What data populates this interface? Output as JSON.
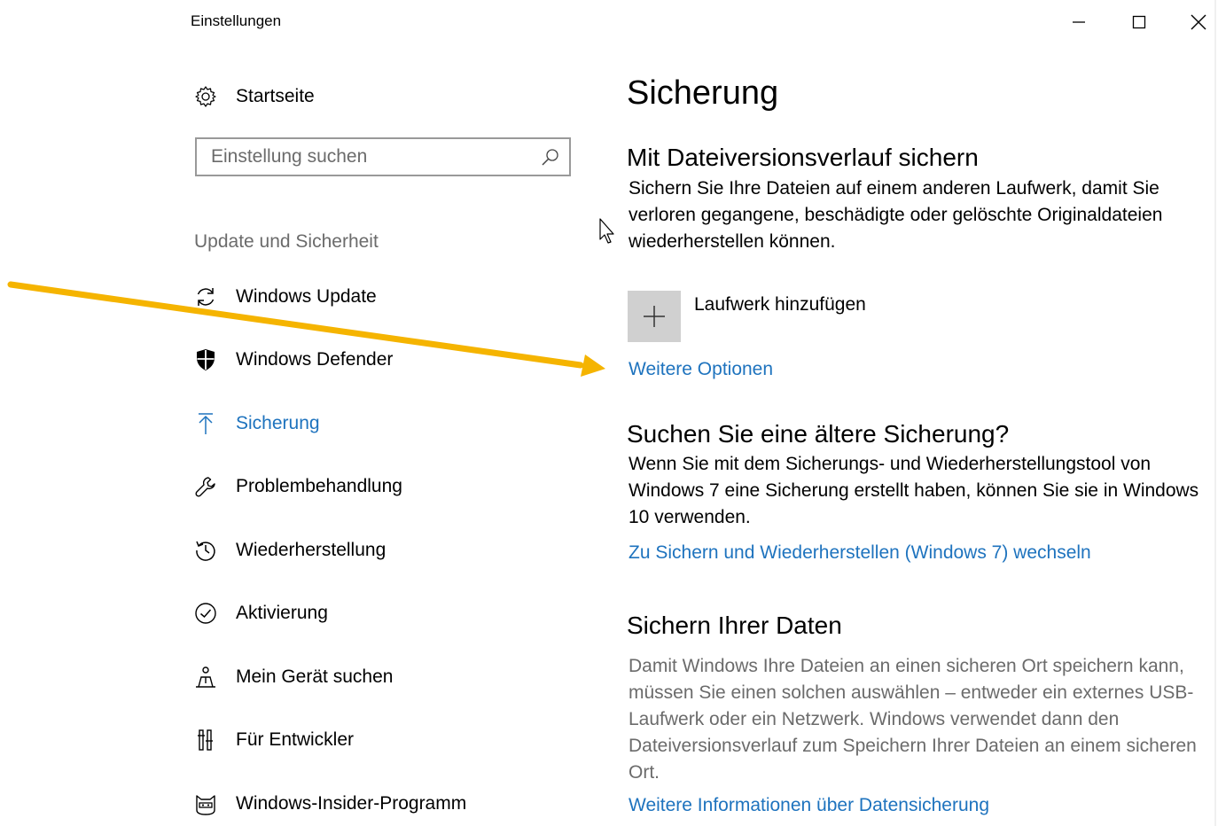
{
  "window": {
    "title": "Einstellungen",
    "controls": [
      "minimize",
      "maximize",
      "close"
    ]
  },
  "sidebar": {
    "home": {
      "label": "Startseite",
      "icon": "gear-icon"
    },
    "search": {
      "placeholder": "Einstellung suchen",
      "value": ""
    },
    "section_title": "Update und Sicherheit",
    "items": [
      {
        "label": "Windows Update",
        "icon": "refresh-icon",
        "active": false
      },
      {
        "label": "Windows Defender",
        "icon": "shield-icon",
        "active": false
      },
      {
        "label": "Sicherung",
        "icon": "upload-arrow-icon",
        "active": true
      },
      {
        "label": "Problembehandlung",
        "icon": "wrench-icon",
        "active": false
      },
      {
        "label": "Wiederherstellung",
        "icon": "history-icon",
        "active": false
      },
      {
        "label": "Aktivierung",
        "icon": "check-circle-icon",
        "active": false
      },
      {
        "label": "Mein Gerät suchen",
        "icon": "person-locate-icon",
        "active": false
      },
      {
        "label": "Für Entwickler",
        "icon": "developer-tools-icon",
        "active": false
      },
      {
        "label": "Windows-Insider-Programm",
        "icon": "insider-ninja-cat-icon",
        "active": false
      }
    ]
  },
  "main": {
    "title": "Sicherung",
    "file_history": {
      "heading": "Mit Dateiversionsverlauf sichern",
      "description": "Sichern Sie Ihre Dateien auf einem anderen Laufwerk, damit Sie verloren gegangene, beschädigte oder gelöschte Originaldateien wiederherstellen können.",
      "add_drive_label": "Laufwerk hinzufügen",
      "more_options_link": "Weitere Optionen"
    },
    "older_backup": {
      "heading": "Suchen Sie eine ältere Sicherung?",
      "description": "Wenn Sie mit dem Sicherungs- und Wiederherstellungstool von Windows 7 eine Sicherung erstellt haben, können Sie sie in Windows 10 verwenden.",
      "link": "Zu Sichern und Wiederherstellen (Windows 7) wechseln"
    },
    "backup_data": {
      "heading": "Sichern Ihrer Daten",
      "description": "Damit Windows Ihre Dateien an einen sicheren Ort speichern kann, müssen Sie einen solchen auswählen – entweder ein externes USB-Laufwerk oder ein Netzwerk. Windows verwendet dann den Dateiversionsverlauf zum Speichern Ihrer Dateien an einem sicheren Ort.",
      "link": "Weitere Informationen über Datensicherung"
    }
  },
  "colors": {
    "accent": "#1e73be",
    "annotation_arrow": "#f5b400",
    "gray_text": "#6b6b6b",
    "tile_background": "#d0d0d0"
  }
}
